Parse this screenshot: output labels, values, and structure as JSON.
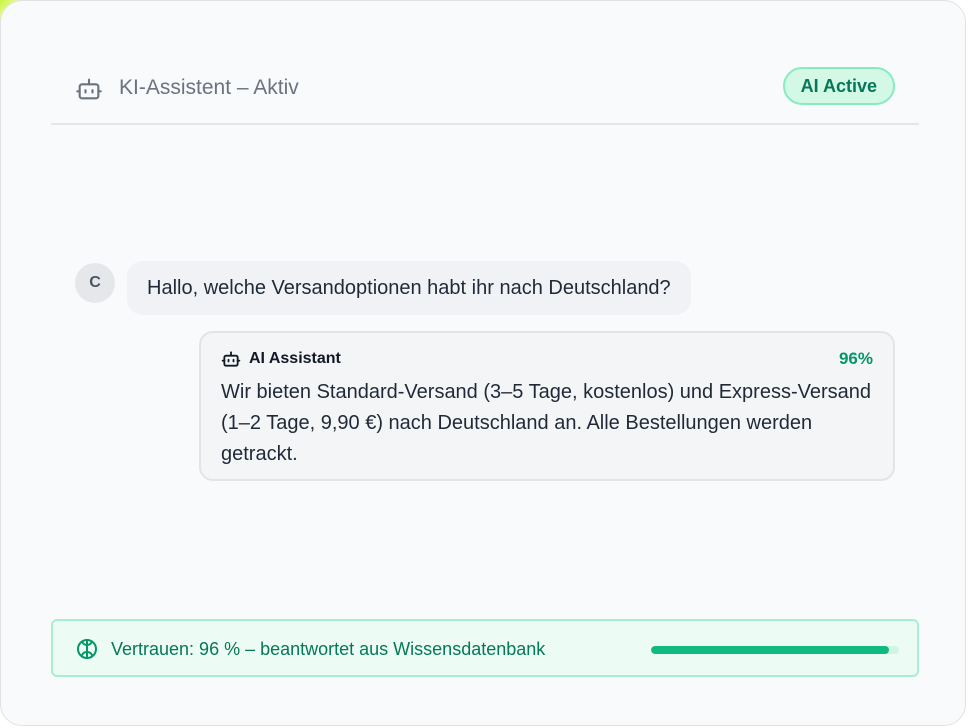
{
  "header": {
    "icon": "robot-icon",
    "title": "KI-Assistent – Aktiv",
    "badge": "AI Active"
  },
  "conversation": {
    "user": {
      "avatar_initial": "C",
      "message": "Hallo, welche Versandoptionen habt ihr nach Deutschland?"
    },
    "assistant": {
      "icon": "robot-icon",
      "name": "AI Assistant",
      "confidence_label": "96%",
      "message": "Wir bieten Standard-Versand (3–5 Tage, kostenlos) und Express-Versand (1–2 Tage, 9,90 €) nach Deutschland an. Alle Bestellungen werden getrackt."
    }
  },
  "footer": {
    "icon": "brain-icon",
    "text": "Vertrauen: 96 % – beantwortet aus Wissensdatenbank",
    "progress": 0.96
  },
  "colors": {
    "accent": "#10b981",
    "accent_dark": "#047857",
    "badge_bg": "#d3f8e6"
  }
}
